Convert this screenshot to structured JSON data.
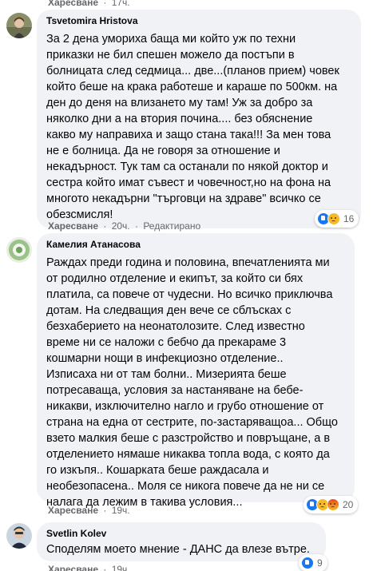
{
  "top_row": {
    "like_label": "Харесване",
    "time": "17ч."
  },
  "comments": [
    {
      "author": "Tsvetomira Hristova",
      "lines": [
        "За 2 дена умориха баща ми който уж по техни",
        "приказки не бил спешен можело да постъпи в",
        "болницата след седмица... две...(планов прием) човек",
        "който беше на крака работеше и караше по 500км. на",
        "ден до деня на влизането му там! Уж за добро за",
        "няколко дни а на втория почина.... без обяснение",
        "какво му направиха и защо стана така!!! За мен това",
        "не е болница. Да не говоря за отношение и",
        "некадърност. Тук там са останали по някой доктор и",
        "сестра който имат съвест и човечност,но на фона на",
        "многото некадърни \"търговци на здраве\" всичко се",
        "обезсмисля!"
      ],
      "like_label": "Харесване",
      "time": "20ч.",
      "edited": "Редактирано",
      "reactions": [
        "like",
        "sad"
      ],
      "reaction_count": "16"
    },
    {
      "author": "Камелия Атанасова",
      "lines": [
        "Раждах преди година и половина, впечатленията ми",
        "от родилно отделение и екипът, за който си бях",
        "платила, са повече от чудесни. Но всичко приключва",
        "дотам. На следващия ден вече се сблъсках с",
        "безхаберието на неонатолозите. След известно",
        "време ни се наложи с бебчо да прекараме 3",
        "кошмарни нощи в инфекциозно отделение..",
        "Изписаха ни от там болни.. Мизерията беше",
        "потресаваща, условия за настаняване на бебе-",
        "никакви, изключително нагло и грубо отношение от",
        "страна на една от сестрите, по-застаряващоа... Общо",
        "взето малкия беше с разстройство и повръщане, а в",
        "отделението нямаше никаква топла вода, с която да",
        "го изкъпя.. Кошарката беше раждасала и",
        "необезопасена.. Моля се никога повече да не ни се",
        "налага да лежим в такива условия..."
      ],
      "like_label": "Харесване",
      "time": "19ч.",
      "reactions": [
        "like",
        "sad",
        "angry"
      ],
      "reaction_count": "20"
    },
    {
      "author": "Svetlin Kolev",
      "lines": [
        "Споделям моето мнение - ДАНС да влезе вътре."
      ],
      "like_label": "Харесване",
      "time": "19ч.",
      "reactions": [
        "like"
      ],
      "reaction_count": "9"
    }
  ],
  "colors": {
    "bubble": "#f0f2f5",
    "meta_text": "#65676b",
    "like_blue": "#1877f2",
    "sad_yellow": "#f7b928",
    "angry_red": "#e8491d"
  }
}
